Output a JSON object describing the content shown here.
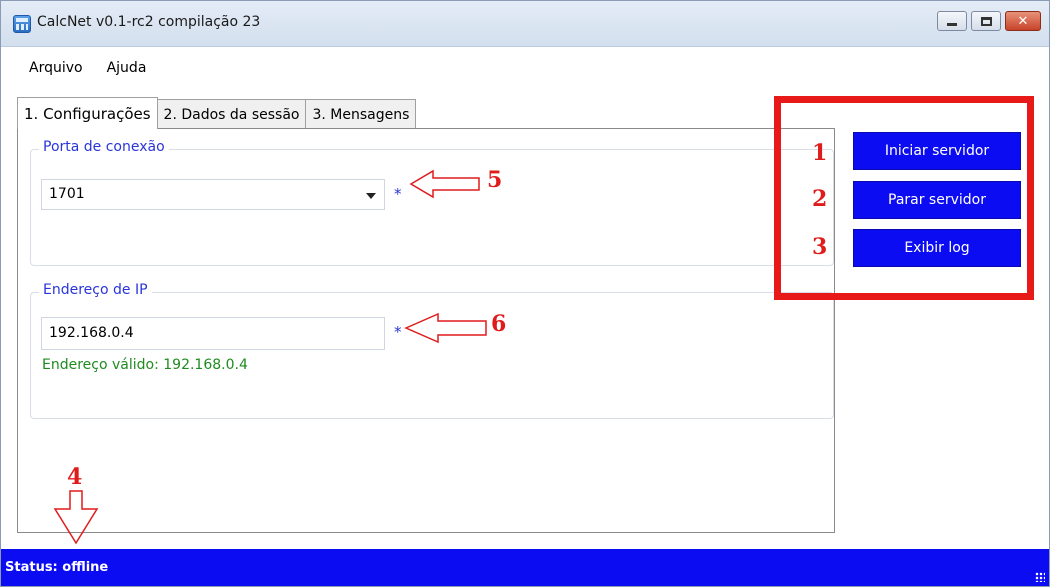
{
  "window": {
    "title": "CalcNet v0.1-rc2 compilação 23",
    "icon": "calculator-icon"
  },
  "menu": {
    "items": [
      {
        "label": "Arquivo"
      },
      {
        "label": "Ajuda"
      }
    ]
  },
  "tabs": [
    {
      "label": "1. Configurações",
      "active": true
    },
    {
      "label": "2. Dados da sessão",
      "active": false
    },
    {
      "label": "3. Mensagens",
      "active": false
    }
  ],
  "port_group": {
    "legend": "Porta de conexão",
    "value": "1701",
    "required_mark": "*"
  },
  "ip_group": {
    "legend": "Endereço de IP",
    "value": "192.168.0.4",
    "required_mark": "*",
    "validation": "Endereço válido: 192.168.0.4"
  },
  "actions": {
    "start": "Iniciar servidor",
    "stop": "Parar servidor",
    "log": "Exibir log"
  },
  "annotations": {
    "n1": "1",
    "n2": "2",
    "n3": "3",
    "n4": "4",
    "n5": "5",
    "n6": "6"
  },
  "status": {
    "text": "Status: offline"
  },
  "colors": {
    "accent_blue": "#0c0cf2",
    "legend_blue": "#2a35d8",
    "annotation_red": "#e01b1b",
    "valid_green": "#1e8c1e"
  }
}
